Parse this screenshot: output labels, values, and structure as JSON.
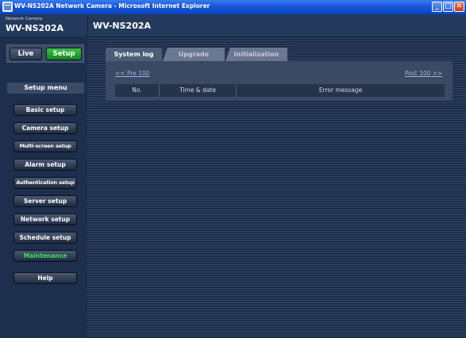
{
  "window": {
    "title": "WV-NS202A Network Camera - Microsoft Internet Explorer",
    "minimize_glyph": "_",
    "maximize_glyph": "□",
    "close_glyph": "✕"
  },
  "header": {
    "brand_label": "Network Camera",
    "brand_model": "WV-NS202A",
    "page_model": "WV-NS202A"
  },
  "mode": {
    "live": "Live",
    "setup": "Setup"
  },
  "sidebar": {
    "title": "Setup menu",
    "items": [
      {
        "label": "Basic setup"
      },
      {
        "label": "Camera setup"
      },
      {
        "label": "Multi-screen setup"
      },
      {
        "label": "Alarm setup"
      },
      {
        "label": "Authentication setup"
      },
      {
        "label": "Server setup"
      },
      {
        "label": "Network setup"
      },
      {
        "label": "Schedule setup"
      },
      {
        "label": "Maintenance"
      }
    ],
    "help": "Help"
  },
  "tabs": [
    {
      "label": "System log"
    },
    {
      "label": "Upgrade"
    },
    {
      "label": "Initialization"
    }
  ],
  "log": {
    "prev_link": "<< Pre 100",
    "next_link": "Post 100 >>",
    "columns": [
      "No.",
      "Time & date",
      "Error message"
    ]
  },
  "colors": {
    "setup_active": "#0e8a1c",
    "maintenance_active_text": "#3fe05a",
    "header_bg": "#243a5c"
  }
}
